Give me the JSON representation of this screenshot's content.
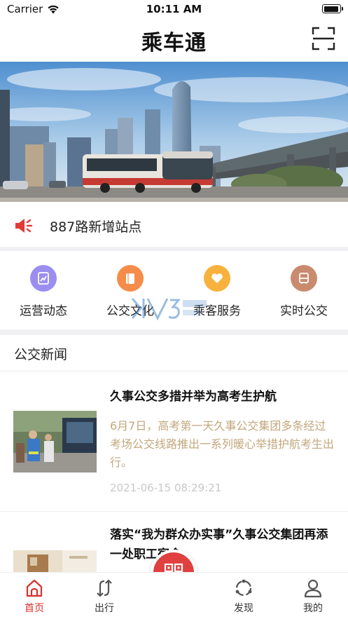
{
  "status_bar": {
    "carrier": "Carrier",
    "time": "10:11 AM",
    "battery_level": 0.95
  },
  "nav": {
    "title": "乘车通",
    "scan_icon": "scan-icon"
  },
  "banner": {
    "alt": "banner-image"
  },
  "notice": {
    "icon": "speaker-icon",
    "text": "887路新增站点"
  },
  "quick_menu": {
    "items": [
      {
        "label": "运营动态",
        "icon": "chart-icon",
        "color": "#9a8ef0"
      },
      {
        "label": "公交文化",
        "icon": "book-icon",
        "color": "#f58c4a"
      },
      {
        "label": "乘客服务",
        "icon": "heart-icon",
        "color": "#f7b23e"
      },
      {
        "label": "实时公交",
        "icon": "bus-icon",
        "color": "#c98a6e"
      }
    ]
  },
  "news": {
    "section_title": "公交新闻",
    "items": [
      {
        "title": "久事公交多措并举为高考生护航",
        "summary": "6月7日，高考第一天久事公交集团多条经过考场公交线路推出一系列暖心举措护航考生出行。",
        "date": "2021-06-15 08:29:21"
      },
      {
        "title": "落实“我为群众办实事”久事公交集团再添一处职工宿舍",
        "summary": "",
        "date": ""
      }
    ]
  },
  "tab_bar": {
    "tabs": [
      {
        "label": "首页",
        "icon": "home-icon",
        "active": true
      },
      {
        "label": "出行",
        "icon": "route-icon",
        "active": false
      },
      {
        "label": "发现",
        "icon": "discover-icon",
        "active": false
      },
      {
        "label": "我的",
        "icon": "user-icon",
        "active": false
      }
    ],
    "center": {
      "icon": "qr-code-icon"
    }
  },
  "colors": {
    "accent": "#d9302c",
    "summary_text": "#c2a77d",
    "date_text": "#c8c8c8",
    "divider": "#f1f1f3"
  }
}
